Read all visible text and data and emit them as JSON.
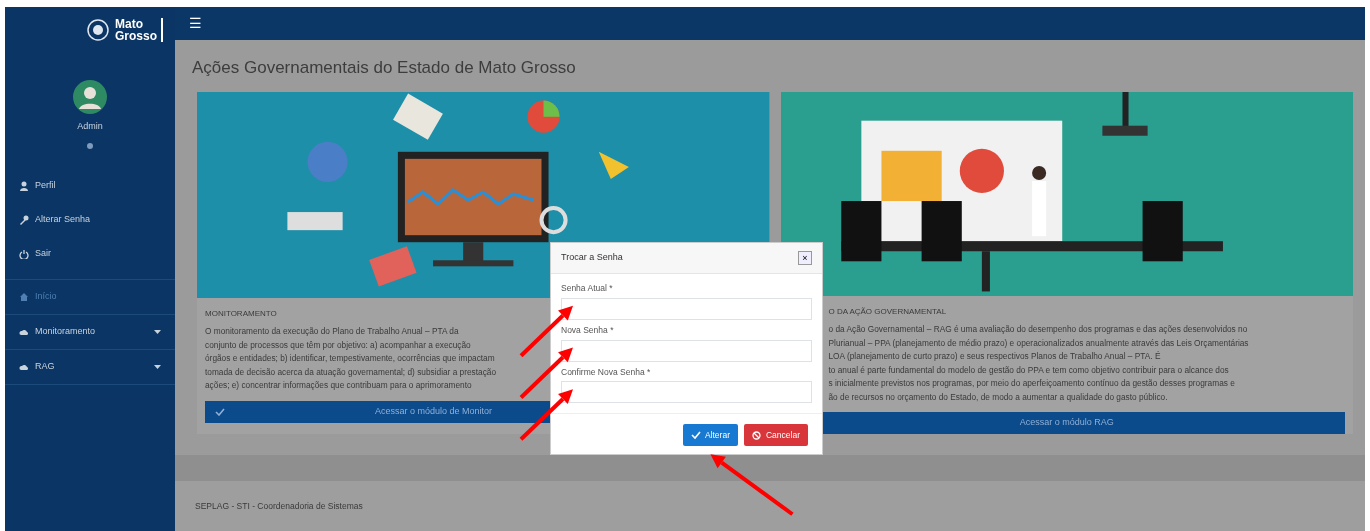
{
  "sidebar": {
    "logo": {
      "lines": [
        "Mato",
        "Grosso"
      ]
    },
    "user": {
      "name": "Admin"
    },
    "items": [
      {
        "label": "Perfil",
        "selected": false,
        "caret": false
      },
      {
        "label": "Alterar Senha",
        "selected": false,
        "caret": false
      },
      {
        "label": "Sair",
        "selected": false,
        "caret": false
      },
      {
        "label": "Início",
        "selected": true,
        "caret": false
      },
      {
        "label": "Monitoramento",
        "selected": false,
        "caret": true
      },
      {
        "label": "RAG",
        "selected": false,
        "caret": true
      }
    ]
  },
  "topbar": {
    "menu_glyph": "☰"
  },
  "page_title": "Ações Governamentais do Estado de Mato Grosso",
  "cards": [
    {
      "title": "MONITORAMENTO",
      "lines": [
        "O monitoramento da execução do Plano de Trabalho Anual – PTA da",
        "conjunto de processos que têm por objetivo: a) acompanhar a execução",
        "órgãos e entidades; b) identificar, tempestivamente, ocorrências que impactam",
        "tomada de decisão acerca da atuação governamental; d) subsidiar a prestação",
        "ações; e) concentrar informações que contribuam para o aprimoramento"
      ],
      "button": "Acessar o módulo de Monitor",
      "button_icon": true
    },
    {
      "title": "O DA AÇÃO GOVERNAMENTAL",
      "lines": [
        "o da Ação Governamental – RAG é uma avaliação do desempenho dos programas e das ações desenvolvidos no",
        "Plurianual – PPA (planejamento de médio prazo) e operacionalizados anualmente através das Leis Orçamentárias",
        "LOA (planejamento de curto prazo) e seus respectivos Planos de Trabalho Anual – PTA. É",
        "to anual é parte fundamental do modelo de gestão do PPA e tem como objetivo contribuir para o alcance dos",
        "s inicialmente previstos nos programas, por meio do aperfeiçoamento contínuo da gestão desses programas e",
        "ão de recursos no orçamento do Estado, de modo a aumentar a qualidade do gasto público."
      ],
      "button": "Acessar o módulo RAG",
      "button_icon": false
    }
  ],
  "footer": "SEPLAG - STI - Coordenadoria de Sistemas",
  "modal": {
    "title": "Trocar a Senha",
    "close": "×",
    "fields": [
      {
        "label": "Senha Atual *"
      },
      {
        "label": "Nova Senha *"
      },
      {
        "label": "Confirme Nova Senha *"
      }
    ],
    "buttons": [
      {
        "label": "Alterar",
        "kind": "confirm"
      },
      {
        "label": "Cancelar",
        "kind": "cancel"
      }
    ]
  },
  "annotations": [
    {
      "kind": "arrow"
    },
    {
      "kind": "arrow"
    },
    {
      "kind": "arrow"
    },
    {
      "kind": "arrow"
    }
  ]
}
